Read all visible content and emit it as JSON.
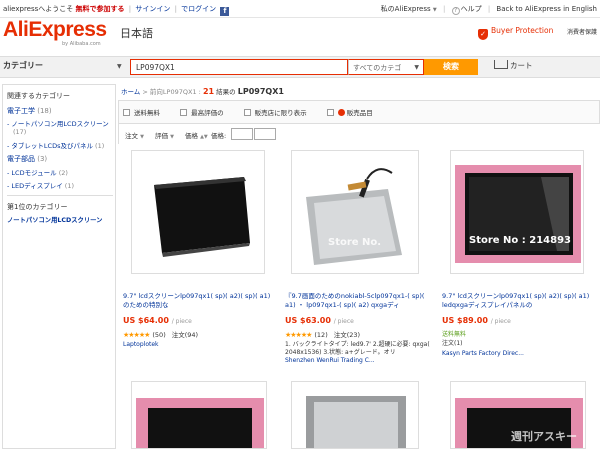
{
  "topbar": {
    "welcome": "aliexpressへようこそ",
    "join": "無料で参加する",
    "signin": "サインイン",
    "login": "でログイン",
    "fb": "f",
    "my_ali": "私のAliExpress",
    "help": "ヘルプ",
    "back_link": "Back to AliExpress in English"
  },
  "header": {
    "logo": "AliExpress",
    "logo_sub": "by Alibaba.com",
    "lang": "日本語",
    "buyer_protection": "Buyer Protection",
    "consumer": "消費者保護"
  },
  "catbar": {
    "category_label": "カテゴリー",
    "search_value": "LP097QX1",
    "select_value": "すべてのカテゴ",
    "search_button": "検索",
    "cart": "カート"
  },
  "sidebar": {
    "title": "関連するカテゴリー",
    "items": [
      {
        "label": "電子工学",
        "count": "(18)"
      },
      {
        "label": "- ノートパソコン用LCDスクリーン",
        "count": "(17)"
      },
      {
        "label": "- タブレットLCDs及びパネル",
        "count": "(1)"
      },
      {
        "label": "電子部品",
        "count": "(3)"
      },
      {
        "label": "- LCDモジュール",
        "count": "(2)"
      },
      {
        "label": "- LEDディスプレイ",
        "count": "(1)"
      }
    ],
    "top_category_title": "第1位のカテゴリー",
    "top_category": "ノートパソコン用LCDスクリーン"
  },
  "breadcrumb": {
    "home": "ホーム",
    "sep": ">",
    "path": "前向LP097QX1",
    "count_sep": ":",
    "count": "21",
    "results": "結果の",
    "keyword": "LP097QX1"
  },
  "filters": {
    "free_shipping": "送料無料",
    "top_rated": "最高評価の",
    "per_piece": "販売店に限り表示",
    "mall": "販売品目",
    "sort_new": "注文",
    "sort_rating": "評価",
    "sort_price": "価格",
    "price_label": "価格:",
    "dash": "-"
  },
  "products": [
    {
      "title": "9.7\" lcdスクリーンlp097qx1( sp)( a2)( sp)( a1)のための特別な",
      "price": "US $64.00",
      "per": "/ piece",
      "stars": "★★★★★",
      "reviews": "(50)",
      "orders": "注文(94)",
      "store": "Laptoplotek",
      "note": ""
    },
    {
      "title": "『9.7画面のためのnokiabl-5clp097qx1-( sp)( a1) ・ lp097qx1-( sp)( a2) qxgaディ",
      "price": "US $63.00",
      "per": "/ piece",
      "stars": "★★★★★",
      "reviews": "(12)",
      "orders": "注文(23)",
      "store": "Shenzhen WenRui Trading C...",
      "note": "1. バックライトタイプ: led9.7' 2.超硬に必要: qxga( 2048x1536) 3.状態: a+グレード。オリ"
    },
    {
      "title": "9.7\" lcdスクリーンlp097qx1( sp)( a2)( sp)( a1) ledqxgaディスプレイパネルの",
      "price": "US $89.00",
      "per": "/ piece",
      "freeship": "送料無料",
      "orders": "注文(1)",
      "store": "Kasyn Parts Factory Direc...",
      "store_overlay": "Store No : 214893"
    }
  ],
  "overlays": {
    "store_watermark": "Store No.",
    "watermark": "週刊アスキー"
  },
  "colors": {
    "brand": "#e62e04",
    "link": "#003399",
    "search_button": "#ff9900"
  }
}
